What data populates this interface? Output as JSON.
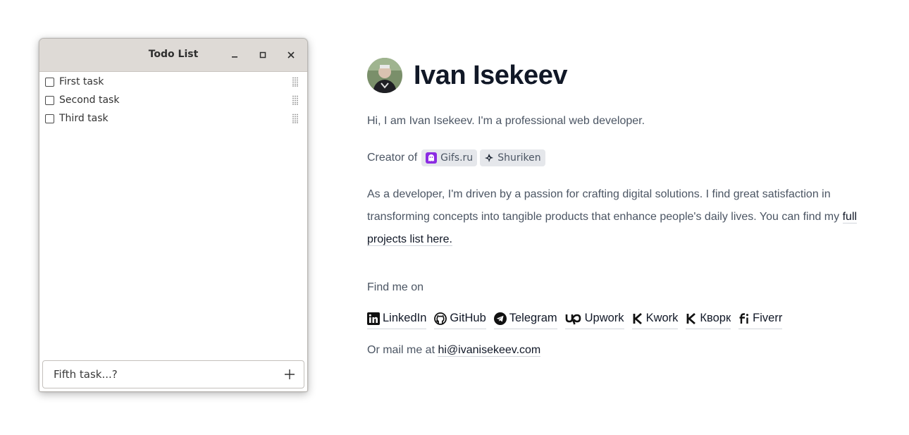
{
  "window": {
    "title": "Todo List",
    "tasks": [
      {
        "label": "First task",
        "checked": false
      },
      {
        "label": "Second task",
        "checked": false
      },
      {
        "label": "Third task",
        "checked": false
      }
    ],
    "new_task_placeholder": "Fifth task...?",
    "icons": {
      "minimize": "minimize-icon",
      "maximize": "maximize-icon",
      "close": "close-icon",
      "add": "plus-icon",
      "drag": "drag-handle-icon"
    }
  },
  "profile": {
    "name": "Ivan Isekeev",
    "intro": "Hi, I am Ivan Isekeev. I'm a professional web developer.",
    "creator_prefix": "Creator of",
    "projects": [
      {
        "label": "Gifs.ru",
        "icon": "gifs-ghost-icon",
        "color": "#8b2be2"
      },
      {
        "label": "Shuriken",
        "icon": "shuriken-icon",
        "color": "#1f2937"
      }
    ],
    "about_text": "As a developer, I'm driven by a passion for crafting digital solutions. I find great satisfaction in transforming concepts into tangible products that enhance people's daily lives. You can find my",
    "about_link": "full projects list here.",
    "find_me": "Find me on",
    "socials": [
      {
        "label": "LinkedIn",
        "icon": "linkedin-icon"
      },
      {
        "label": "GitHub",
        "icon": "github-icon"
      },
      {
        "label": "Telegram",
        "icon": "telegram-icon"
      },
      {
        "label": "Upwork",
        "icon": "upwork-icon"
      },
      {
        "label": "Kwork",
        "icon": "kwork-icon"
      },
      {
        "label": "Кворк",
        "icon": "kwork-icon"
      },
      {
        "label": "Fiverr",
        "icon": "fiverr-icon"
      }
    ],
    "mail_prefix": "Or mail me at",
    "email": "hi@ivanisekeev.com"
  },
  "colors": {
    "text_primary": "#111827",
    "text_muted": "#4b5563",
    "chip_bg": "#e5e7eb",
    "titlebar": "#dedad6"
  }
}
